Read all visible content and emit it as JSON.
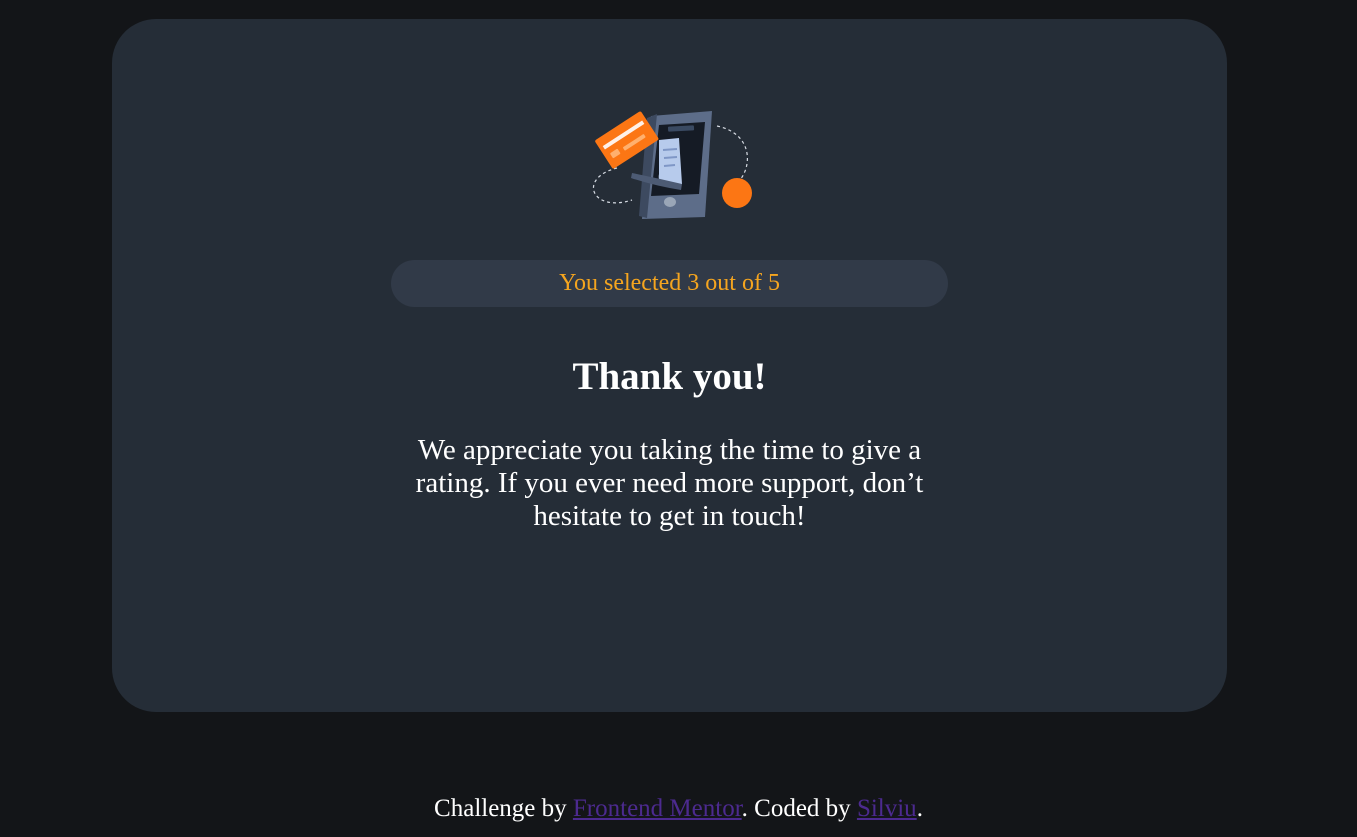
{
  "card": {
    "illustration_icon": "thank-you-phone-illustration",
    "selected_text": "You selected 3 out of 5",
    "title": "Thank you!",
    "message": "We appreciate you taking the time to give a rating. If you ever need more support, don’t hesitate to get in touch!"
  },
  "footer": {
    "prefix": "Challenge by ",
    "link1_label": "Frontend Mentor",
    "middle": ". Coded by ",
    "link2_label": "Silviu",
    "suffix": "."
  },
  "colors": {
    "page_bg": "#131518",
    "card_bg": "#252d37",
    "pill_bg": "#313a48",
    "accent_orange": "#f5a51f",
    "link_purple": "#4c2a8f"
  }
}
